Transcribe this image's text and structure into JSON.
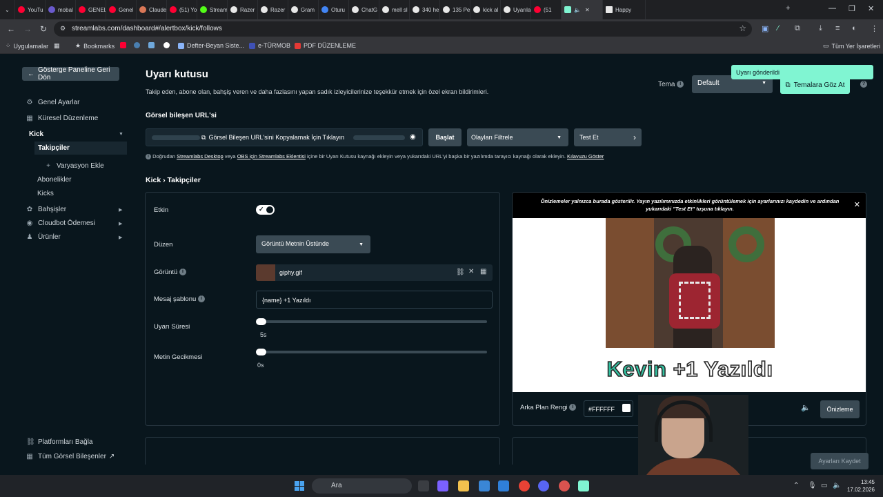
{
  "browser": {
    "tabs": [
      {
        "label": "YouTu",
        "color": "#ff0033"
      },
      {
        "label": "mobal",
        "color": "#6a5acd"
      },
      {
        "label": "GENEL",
        "color": "#ff0033"
      },
      {
        "label": "Genel",
        "color": "#ff0033"
      },
      {
        "label": "Claude",
        "color": "#d97757"
      },
      {
        "label": "(51) Yo",
        "color": "#ff0033"
      },
      {
        "label": "Stream",
        "color": "#53fc18"
      },
      {
        "label": "Razer",
        "color": "#e8e8e8"
      },
      {
        "label": "Razer",
        "color": "#e8e8e8"
      },
      {
        "label": "Gram",
        "color": "#e8e8e8"
      },
      {
        "label": "Oturu",
        "color": "#4285f4"
      },
      {
        "label": "ChatG",
        "color": "#e8e8e8"
      },
      {
        "label": "mell sl",
        "color": "#e8e8e8"
      },
      {
        "label": "340 he",
        "color": "#e8e8e8"
      },
      {
        "label": "135 Pe",
        "color": "#e8e8e8"
      },
      {
        "label": "kick al",
        "color": "#e8e8e8"
      },
      {
        "label": "Uyarıla",
        "color": "#e8e8e8"
      },
      {
        "label": "(51",
        "color": "#ff0033"
      }
    ],
    "active_tab_color": "#80f5d2",
    "happy_tab": "Happy",
    "url": "streamlabs.com/dashboard#/alertbox/kick/follows",
    "bookmarks": {
      "apps": "Uygulamalar",
      "bookmarks": "Bookmarks",
      "defter": "Defter-Beyan Siste...",
      "turmob": "e-TÜRMOB",
      "pdf": "PDF DÜZENLEME",
      "all": "Tüm Yer İşaretleri"
    }
  },
  "sidebar": {
    "back": "Gösterge Paneline Geri Dön",
    "general": "Genel Ayarlar",
    "global": "Küresel Düzenleme",
    "kick": "Kick",
    "followers": "Takipçiler",
    "add_variation": "Varyasyon Ekle",
    "subscribers": "Abonelikler",
    "kicks": "Kicks",
    "donations": "Bahşişler",
    "cloudbot": "Cloudbot Ödemesi",
    "products": "Ürünler",
    "connect": "Platformları Bağla",
    "all_widgets": "Tüm Görsel Bileşenler"
  },
  "header": {
    "title": "Uyarı kutusu",
    "description": "Takip eden, abone olan, bahşiş veren ve daha fazlasını yapan sadık izleyicilerinize teşekkür etmek için özel ekran bildirimleri.",
    "theme_label": "Tema",
    "theme_value": "Default",
    "browse_themes": "Temalara Göz At",
    "toast": "Uyarı gönderildi"
  },
  "widget_url": {
    "label": "Görsel bileşen URL'si",
    "copy_text": "Görsel Bileşen URL'sini Kopyalamak İçin Tıklayın",
    "start": "Başlat",
    "filter": "Olayları Filtrele",
    "test": "Test Et",
    "help_prefix": "Doğrudan",
    "help_link1": "Streamlabs Desktop",
    "help_mid1": "veya",
    "help_link2": "OBS için Streamlabs Eklentisi",
    "help_mid2": "içine bir Uyarı Kutusu kaynağı ekleyin veya yukarıdaki URL'yi başka bir yazılımda tarayıcı kaynağı olarak ekleyin.",
    "help_link3": "Kılavuzu Göster"
  },
  "breadcrumb": {
    "root": "Kick",
    "sep": "›",
    "current": "Takipçiler"
  },
  "settings": {
    "enabled_label": "Etkin",
    "enabled": true,
    "layout_label": "Düzen",
    "layout_value": "Görüntü Metnin Üstünde",
    "image_label": "Görüntü",
    "image_value": "giphy.gif",
    "message_label": "Mesaj şablonu",
    "message_value": "{name} +1 Yazıldı",
    "duration_label": "Uyarı Süresi",
    "duration_value": "5s",
    "duration_fraction": 0.0,
    "delay_label": "Metin Gecikmesi",
    "delay_value": "0s",
    "delay_fraction": 0.0
  },
  "preview": {
    "notice": "Önizlemeler yalnızca burada gösterilir. Yayın yazılımınızda etkinlikleri görüntülemek için ayarlarınızı kaydedin ve ardından yukarıdaki \"Test Et\" tuşuna tıklayın.",
    "alert_name": "Kevin",
    "alert_rest": "+1 Yazıldı",
    "name_color": "#32c3a2",
    "bg_label": "Arka Plan Rengi",
    "bg_value": "#FFFFFF",
    "preview_button": "Önizleme"
  },
  "footer": {
    "save": "Ayarları Kaydet"
  },
  "taskbar": {
    "search": "Ara",
    "time": "13:45",
    "date": "17.02.2026"
  }
}
